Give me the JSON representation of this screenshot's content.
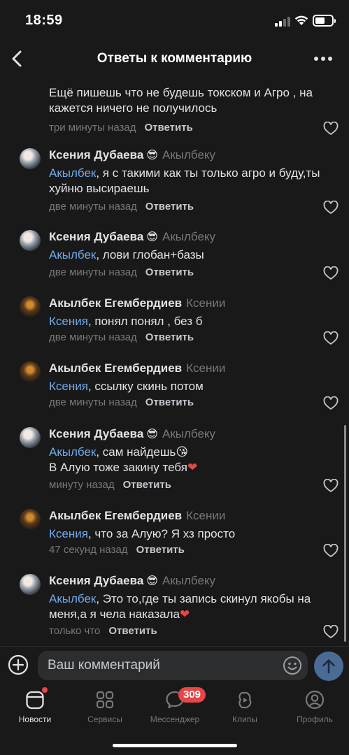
{
  "status_bar": {
    "time": "18:59"
  },
  "header": {
    "title": "Ответы к комментарию"
  },
  "comments": [
    {
      "author": "",
      "emoji": "",
      "reply_to": "",
      "mention": "",
      "text": "Ещё пишешь что не будешь токском и Агро , на кажется ничего не получилось",
      "text2": "",
      "time": "три минуты назад",
      "answer": "Ответить"
    },
    {
      "author": "Ксения Дубаева",
      "emoji": "😎",
      "reply_to": "Акылбеку",
      "mention": "Акылбек",
      "text": ", я с такими как ты только агро и буду,ты хуйню высираешь",
      "text2": "",
      "time": "две минуты назад",
      "answer": "Ответить"
    },
    {
      "author": "Ксения Дубаева",
      "emoji": "😎",
      "reply_to": "Акылбеку",
      "mention": "Акылбек",
      "text": ", лови глобан+базы",
      "text2": "",
      "time": "две минуты назад",
      "answer": "Ответить"
    },
    {
      "author": "Акылбек Егембердиев",
      "emoji": "",
      "reply_to": "Ксении",
      "mention": "Ксения",
      "text": ", понял понял , без б",
      "text2": "",
      "time": "две минуты назад",
      "answer": "Ответить"
    },
    {
      "author": "Акылбек Егембердиев",
      "emoji": "",
      "reply_to": "Ксении",
      "mention": "Ксения",
      "text": ", ссылку скинь потом",
      "text2": "",
      "time": "две минуты назад",
      "answer": "Ответить"
    },
    {
      "author": "Ксения Дубаева",
      "emoji": "😎",
      "reply_to": "Акылбеку",
      "mention": "Акылбек",
      "text": ", сам найдешь😘",
      "text2": "В Алую тоже закину тебя",
      "time": "минуту назад",
      "answer": "Ответить"
    },
    {
      "author": "Акылбек Егембердиев",
      "emoji": "",
      "reply_to": "Ксении",
      "mention": "Ксения",
      "text": ", что за Алую? Я хз просто",
      "text2": "",
      "time": "47 секунд назад",
      "answer": "Ответить"
    },
    {
      "author": "Ксения Дубаева",
      "emoji": "😎",
      "reply_to": "Акылбеку",
      "mention": "Акылбек",
      "text": ", Это то,где ты запись скинул якобы на меня,а я чела наказала",
      "text2": "",
      "time": "только что",
      "answer": "Ответить"
    }
  ],
  "heart_glyph": "❤",
  "composer": {
    "placeholder": "Ваш комментарий"
  },
  "tabbar": {
    "tabs": [
      {
        "label": "Новости",
        "icon": "news-icon"
      },
      {
        "label": "Сервисы",
        "icon": "services-icon"
      },
      {
        "label": "Мессенджер",
        "icon": "messenger-icon",
        "badge": "309"
      },
      {
        "label": "Клипы",
        "icon": "clips-icon"
      },
      {
        "label": "Профиль",
        "icon": "profile-icon"
      }
    ]
  },
  "colors": {
    "background": "#19191a",
    "mention": "#71aaeb",
    "secondary": "#76787a",
    "badge": "#e64646",
    "send": "#4a6c94"
  }
}
